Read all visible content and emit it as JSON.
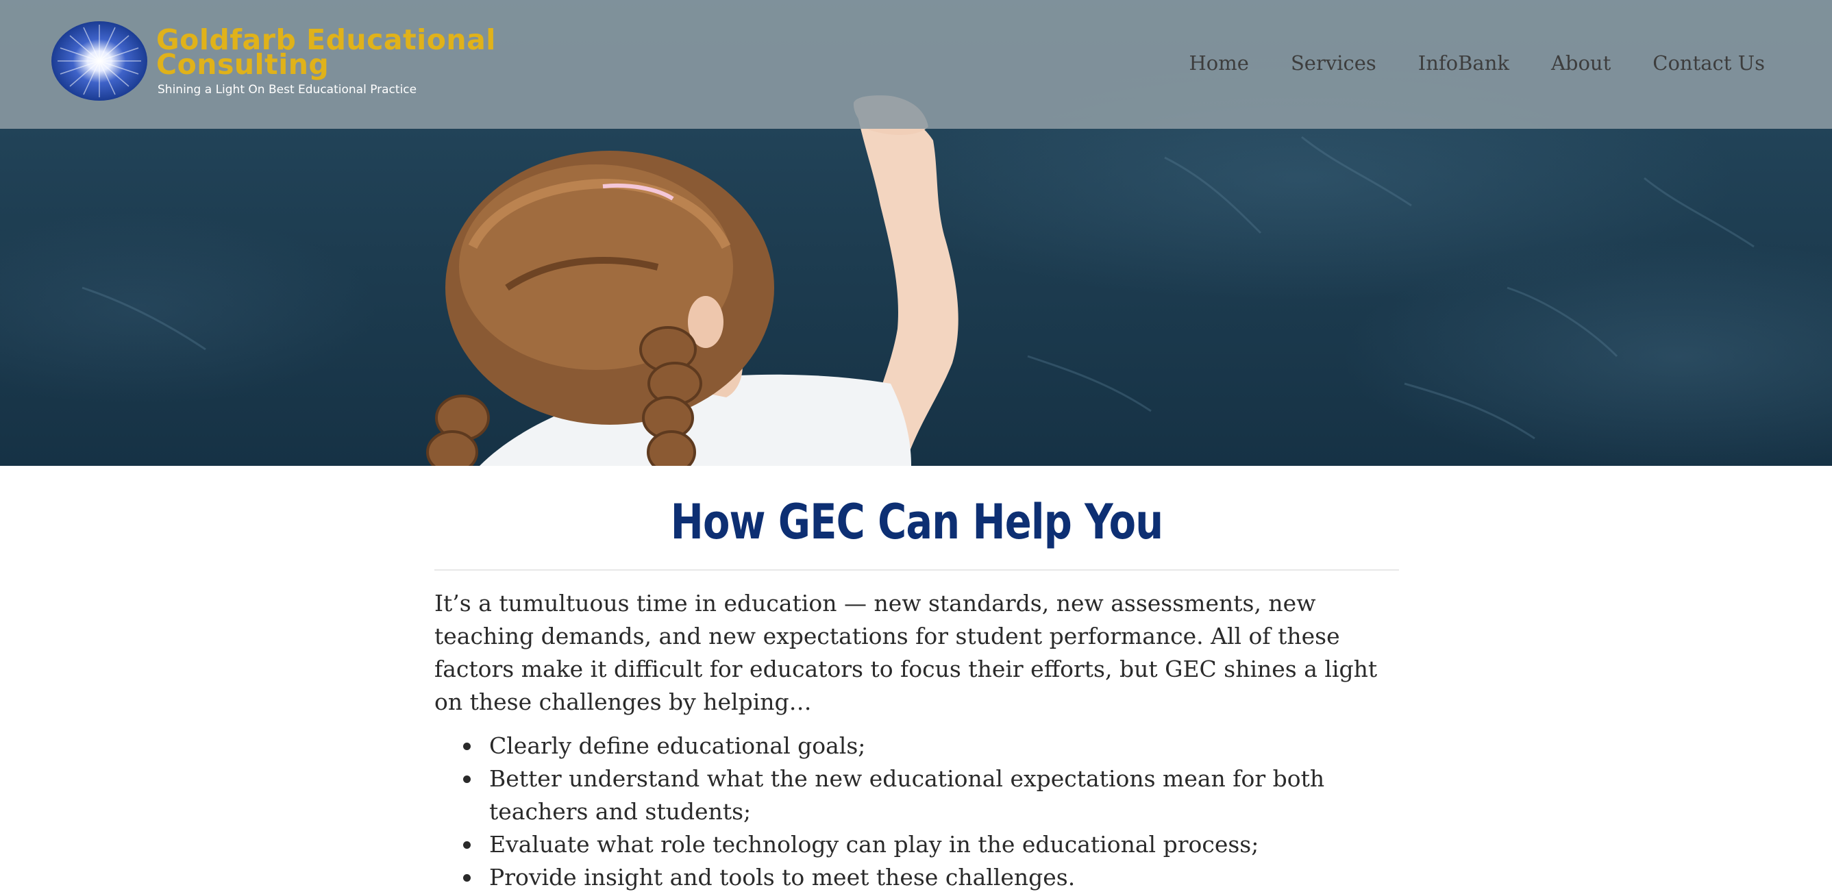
{
  "logo": {
    "line1": "Goldfarb Educational",
    "line2": "Consulting",
    "tagline": "Shining a Light On Best Educational Practice",
    "icon": "sunburst-logo-icon"
  },
  "nav": {
    "items": [
      {
        "label": "Home"
      },
      {
        "label": "Services"
      },
      {
        "label": "InfoBank"
      },
      {
        "label": "About"
      },
      {
        "label": "Contact Us"
      }
    ]
  },
  "main": {
    "title": "How GEC Can Help You",
    "intro": "It’s a tumultuous time in education — new standards, new assessments, new teaching demands, and new expectations for student performance. All of these factors make it difficult for educators to focus their efforts, but GEC shines a light on these challenges by helping…",
    "list": [
      "Clearly define educational goals;",
      "Better understand what the new educational expectations mean for both teachers and students;",
      "Evaluate what role technology can play in the educational process;",
      "Provide insight and tools to meet these challenges."
    ]
  },
  "colors": {
    "brand_gold": "#e0b21a",
    "title_navy": "#0d2f73",
    "header_overlay": "#8c9ba3",
    "chalkboard": "#1d3c50"
  }
}
